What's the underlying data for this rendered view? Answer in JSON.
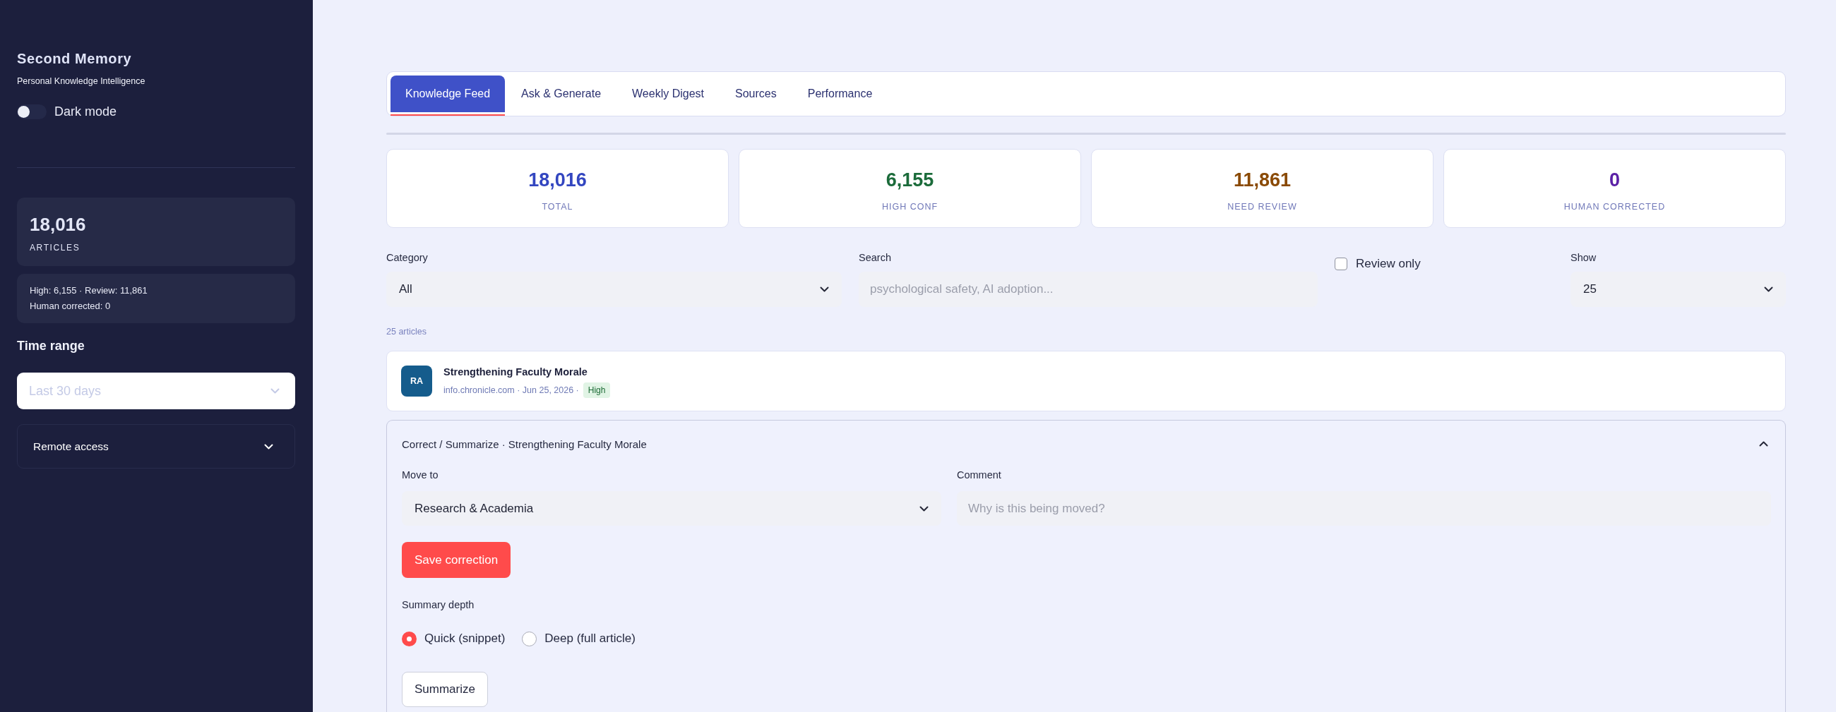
{
  "sidebar": {
    "title": "Second Memory",
    "subtitle": "Personal Knowledge Intelligence",
    "dark_mode": {
      "label": "Dark mode",
      "on": false
    },
    "total": {
      "value": "18,016",
      "label": "ARTICLES"
    },
    "breakdown": [
      "High: 6,155 · Review: 11,861",
      "Human corrected: 0"
    ],
    "time_range": {
      "label": "Time range",
      "value": "Last 30 days"
    },
    "remote_access": {
      "label": "Remote access",
      "expanded": false
    }
  },
  "tabs": [
    {
      "label": "Knowledge Feed",
      "selected": true
    },
    {
      "label": "Ask & Generate",
      "selected": false
    },
    {
      "label": "Weekly Digest",
      "selected": false
    },
    {
      "label": "Sources",
      "selected": false
    },
    {
      "label": "Performance",
      "selected": false
    }
  ],
  "stats": [
    {
      "value": "18,016",
      "label": "TOTAL",
      "color": "#3346c0"
    },
    {
      "value": "6,155",
      "label": "HIGH CONF",
      "color": "#1b6b3a"
    },
    {
      "value": "11,861",
      "label": "NEED REVIEW",
      "color": "#8a4a05"
    },
    {
      "value": "0",
      "label": "HUMAN CORRECTED",
      "color": "#5b21a6"
    }
  ],
  "filters": {
    "category": {
      "label": "Category",
      "value": "All"
    },
    "search": {
      "label": "Search",
      "placeholder": "psychological safety, AI adoption..."
    },
    "review_only": {
      "label": "Review only",
      "checked": false
    },
    "show": {
      "label": "Show",
      "value": "25"
    }
  },
  "article_count": "25 articles",
  "articles": [
    {
      "initials": "RA",
      "title": "Strengthening Faculty Morale",
      "meta": "info.chronicle.com · Jun 25, 2026 ·",
      "confidence": "High"
    }
  ],
  "correction_panel": {
    "title": "Correct / Summarize · Strengthening Faculty Morale",
    "expanded": true,
    "move_to": {
      "label": "Move to",
      "value": "Research & Academia"
    },
    "comment": {
      "label": "Comment",
      "placeholder": "Why is this being moved?"
    },
    "save_button": "Save correction",
    "summary_depth": {
      "label": "Summary depth",
      "options": [
        {
          "label": "Quick (snippet)",
          "selected": true
        },
        {
          "label": "Deep (full article)",
          "selected": false
        }
      ]
    },
    "summarize_button": "Summarize"
  }
}
